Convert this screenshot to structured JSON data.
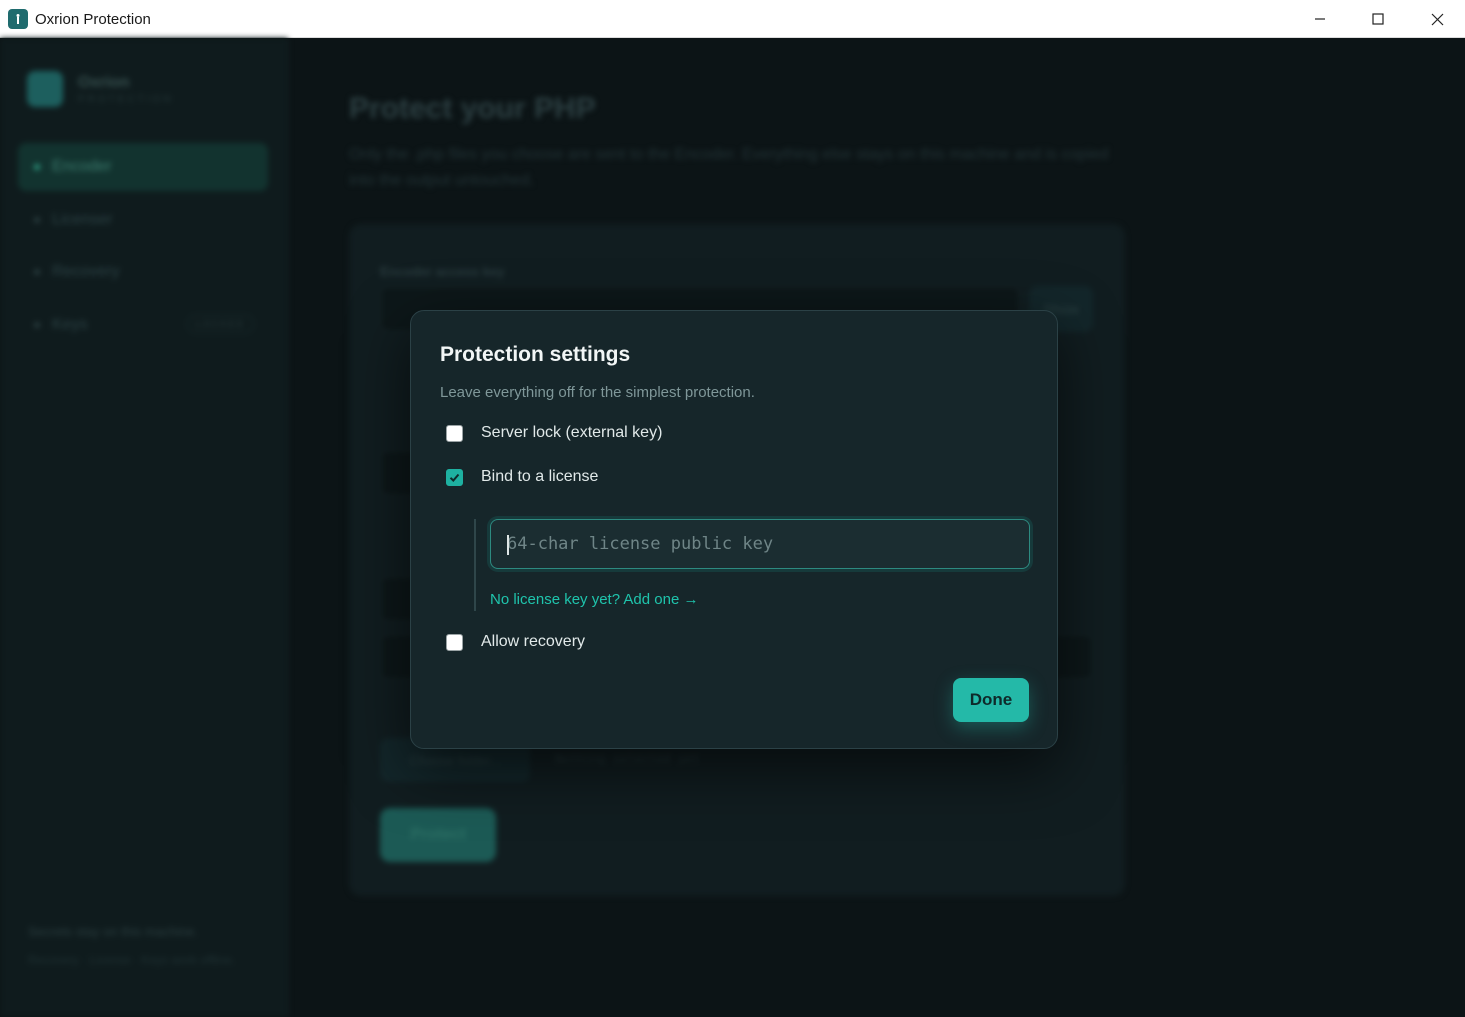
{
  "window": {
    "title": "Oxrion Protection"
  },
  "background": {
    "brand": {
      "name": "Oxrion",
      "subtitle": "PROTECTION"
    },
    "nav": [
      {
        "label": "Encoder",
        "active": true
      },
      {
        "label": "Licenser"
      },
      {
        "label": "Recovery"
      },
      {
        "label": "Keys",
        "badge": "LOCKED"
      }
    ],
    "footer": {
      "line1": "Secrets stay on this machine.",
      "line2": "Recovery · License · Keys work offline."
    },
    "main": {
      "title": "Protect your PHP",
      "description": "Only the .php files you choose are sent to the Encoder. Everything else stays on this machine and is copied into the output untouched.",
      "access_key_label": "Encoder access key",
      "show_label": "Show",
      "choose_folder": "Choose folder...",
      "nothing_selected": "Nothing selected yet",
      "protect_label": "Protect"
    }
  },
  "modal": {
    "title": "Protection settings",
    "subtitle": "Leave everything off for the simplest protection.",
    "options": {
      "server_lock": {
        "label": "Server lock (external key)",
        "checked": false
      },
      "bind_license": {
        "label": "Bind to a license",
        "checked": true
      },
      "allow_recovery": {
        "label": "Allow recovery",
        "checked": false
      }
    },
    "license_input": {
      "placeholder": "64-char license public key",
      "value": ""
    },
    "license_link": "No license key yet? Add one →",
    "done_label": "Done"
  },
  "colors": {
    "accent": "#24b9a8",
    "link": "#1fc4ac",
    "modal_bg": "#16262a"
  }
}
